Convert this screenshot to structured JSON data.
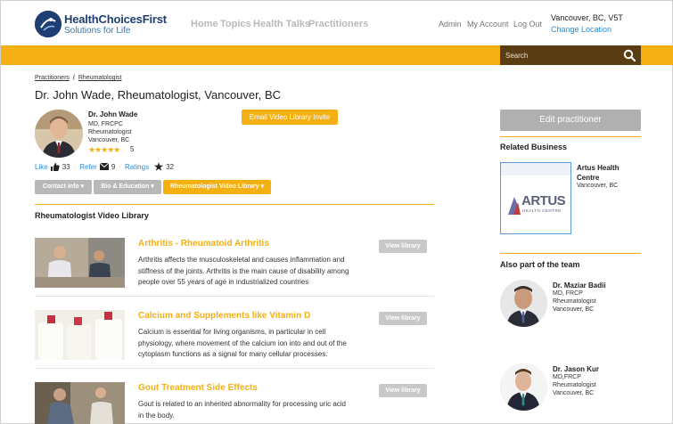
{
  "header": {
    "logo_title": "HealthChoicesFirst",
    "logo_sub": "Solutions for Life",
    "nav": [
      "Home",
      "Topics",
      "Health Talks",
      "Practitioners"
    ],
    "util": [
      "Admin",
      "My Account",
      "Log Out"
    ],
    "location": "Vancouver, BC, V5T",
    "change_location": "Change Location"
  },
  "search": {
    "placeholder": "Search",
    "icon": "search-icon"
  },
  "breadcrumb": [
    "Practitioners",
    "Rheumatologist"
  ],
  "page_title": "Dr. John Wade, Rheumatologist, Vancouver, BC",
  "profile": {
    "name": "Dr. John Wade",
    "credentials": "MD, FRCPC",
    "specialty": "Rheumatologist",
    "city": "Vancouver, BC",
    "stars": "★★★★★",
    "rating_count": "5",
    "email_button": "Email Video Library Invite"
  },
  "stats": {
    "like_label": "Like",
    "like_count": "33",
    "refer_label": "Refer",
    "refer_count": "9",
    "ratings_label": "Ratings",
    "ratings_count": "32"
  },
  "tabs": [
    "Contact info",
    "Bio & Education",
    "Rheumatologist Video Library"
  ],
  "library_title": "Rheumatologist Video Library",
  "videos": [
    {
      "title": "Arthritis - Rheumatoid Arthritis",
      "lines": [
        "Arthritis affects the musculoskeletal and causes inflammation and",
        "stiffness of the joints. Arthritis is the main cause of disability among",
        "people over 55 years of age in industrialized countries"
      ],
      "button": "View library"
    },
    {
      "title": "Calcium and Supplements like Vitamin D",
      "lines": [
        "Calcium is essential for living organisms, in particular in cell",
        "physiology, where movement of the calcium ion into and out of the",
        "cytoplasm functions as a signal for many cellular processes."
      ],
      "button": "View library"
    },
    {
      "title": "Gout Treatment Side Effects",
      "lines": [
        "Gout is related to an inherited abnormality for processing uric acid",
        "in the body."
      ],
      "button": "View library"
    }
  ],
  "right": {
    "edit_button": "Edit practitioner",
    "related_title": "Related Business",
    "business": {
      "name": "Artus Health Centre",
      "city": "Vancouver, BC",
      "logo_main": "ARTUS",
      "logo_sub": "HEALTH CENTRE"
    },
    "team_title": "Also part of the team",
    "team": [
      {
        "name": "Dr. Maziar Badii",
        "cred": "MD, FRCP",
        "spec": "Rheumatologist",
        "city": "Vancouver, BC"
      },
      {
        "name": "Dr. Jason Kur",
        "cred": "MD,FRCP",
        "spec": "Rheumatologist",
        "city": "Vancouver, BC"
      }
    ]
  },
  "colors": {
    "accent": "#f4b013",
    "search_bg": "#5a3d13",
    "brand": "#1f3e73",
    "link": "#2b8bd8"
  }
}
